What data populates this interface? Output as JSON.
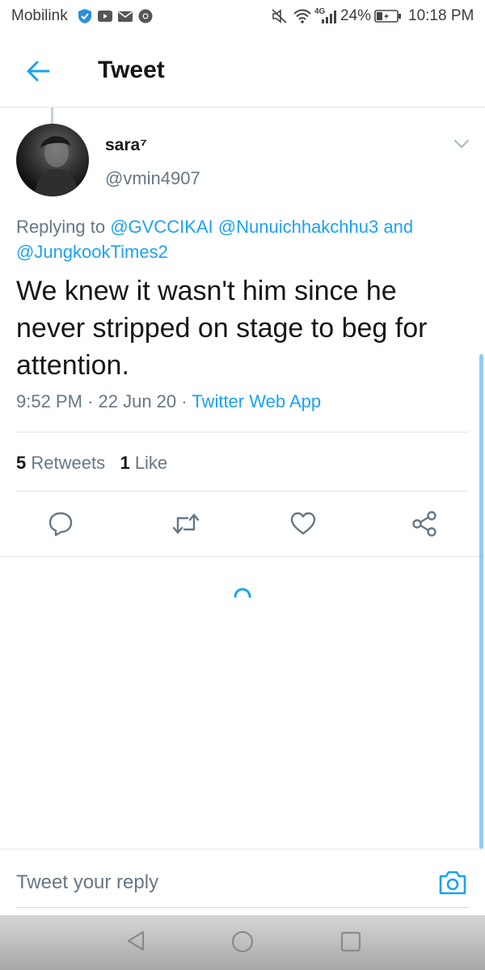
{
  "status_bar": {
    "carrier": "Mobilink",
    "network": "4G",
    "battery": "24%",
    "time": "10:18 PM"
  },
  "header": {
    "title": "Tweet"
  },
  "tweet": {
    "author_name": "sara⁷",
    "author_handle": "@vmin4907",
    "replying_prefix": "Replying to ",
    "mentions": [
      "@GVCCIKAI",
      "@Nunuichhakchhu3",
      "@JungkookTimes2"
    ],
    "mention_joiner": "and",
    "text": "We knew it wasn't him since he never stripped on stage to beg for attention.",
    "time": "9:52 PM",
    "date": "22 Jun 20",
    "source": "Twitter Web App",
    "separator": "·",
    "retweets_count": "5",
    "retweets_label": "Retweets",
    "likes_count": "1",
    "likes_label": "Like"
  },
  "actions": [
    "reply-icon",
    "retweet-icon",
    "like-icon",
    "share-icon"
  ],
  "composer": {
    "placeholder": "Tweet your reply"
  },
  "colors": {
    "accent": "#1da1f2",
    "secondary_text": "#657786",
    "primary_text": "#14171a"
  }
}
